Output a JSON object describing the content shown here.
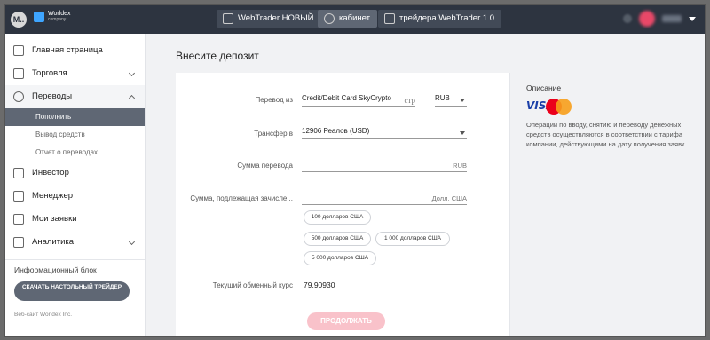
{
  "topbar": {
    "avatar_letter": "M..",
    "logo_name": "Worldex",
    "logo_sub": "company",
    "tabs": [
      {
        "label": "WebTrader НОВЫЙ",
        "icon": "chart-icon"
      },
      {
        "label": "кабинет",
        "icon": "user-icon"
      },
      {
        "label": "трейдера WebTrader 1.0",
        "icon": "chart-icon"
      }
    ]
  },
  "sidebar": {
    "items": [
      {
        "label": "Главная страница",
        "icon": "home-icon"
      },
      {
        "label": "Торговля",
        "icon": "wallet-icon"
      },
      {
        "label": "Переводы",
        "icon": "dollar-icon"
      },
      {
        "label": "Инвестор",
        "icon": "network-icon"
      },
      {
        "label": "Менеджер",
        "icon": "briefcase-icon"
      },
      {
        "label": "Мои заявки",
        "icon": "chat-icon"
      },
      {
        "label": "Аналитика",
        "icon": "trend-icon"
      }
    ],
    "sub_items": [
      "Пополнить",
      "Вывод средств",
      "Отчет о переводах"
    ],
    "info_label": "Информационный блок",
    "download_button": "СКАЧАТЬ НАСТОЛЬНЫЙ ТРЕЙДЕР",
    "footer": "Веб-сайт Worldex Inc."
  },
  "main": {
    "title": "Внесите депозит",
    "form": {
      "transfer_from_label": "Перевод из",
      "transfer_from_value": "Credit/Debit Card SkyCrypto",
      "transfer_from_page": "стр",
      "transfer_from_currency": "RUB",
      "transfer_to_label": "Трансфер в",
      "transfer_to_value": "12906 Реалов (USD)",
      "amount_label": "Сумма перевода",
      "amount_unit": "RUB",
      "credited_label": "Сумма, подлежащая зачисле...",
      "credited_unit": "Долл. США",
      "chips": [
        "100 долларов США",
        "500 долларов США",
        "1 000 долларов США",
        "5 000 долларов США"
      ],
      "rate_label": "Текущий обменный курс",
      "rate_value": "79.90930",
      "continue_button": "ПРОДОЛЖАТЬ"
    },
    "description": {
      "title": "Описание",
      "visa": "VISA",
      "lines": [
        "Операции по вводу, снятию и переводу денежных",
        "средств осуществляются в соответствии с тарифа",
        "компании, действующими на дату получения заявк"
      ]
    }
  },
  "colors": {
    "topbar": "#2d3440",
    "accent": "#5f6774",
    "continue_button": "#f9c2ca"
  }
}
